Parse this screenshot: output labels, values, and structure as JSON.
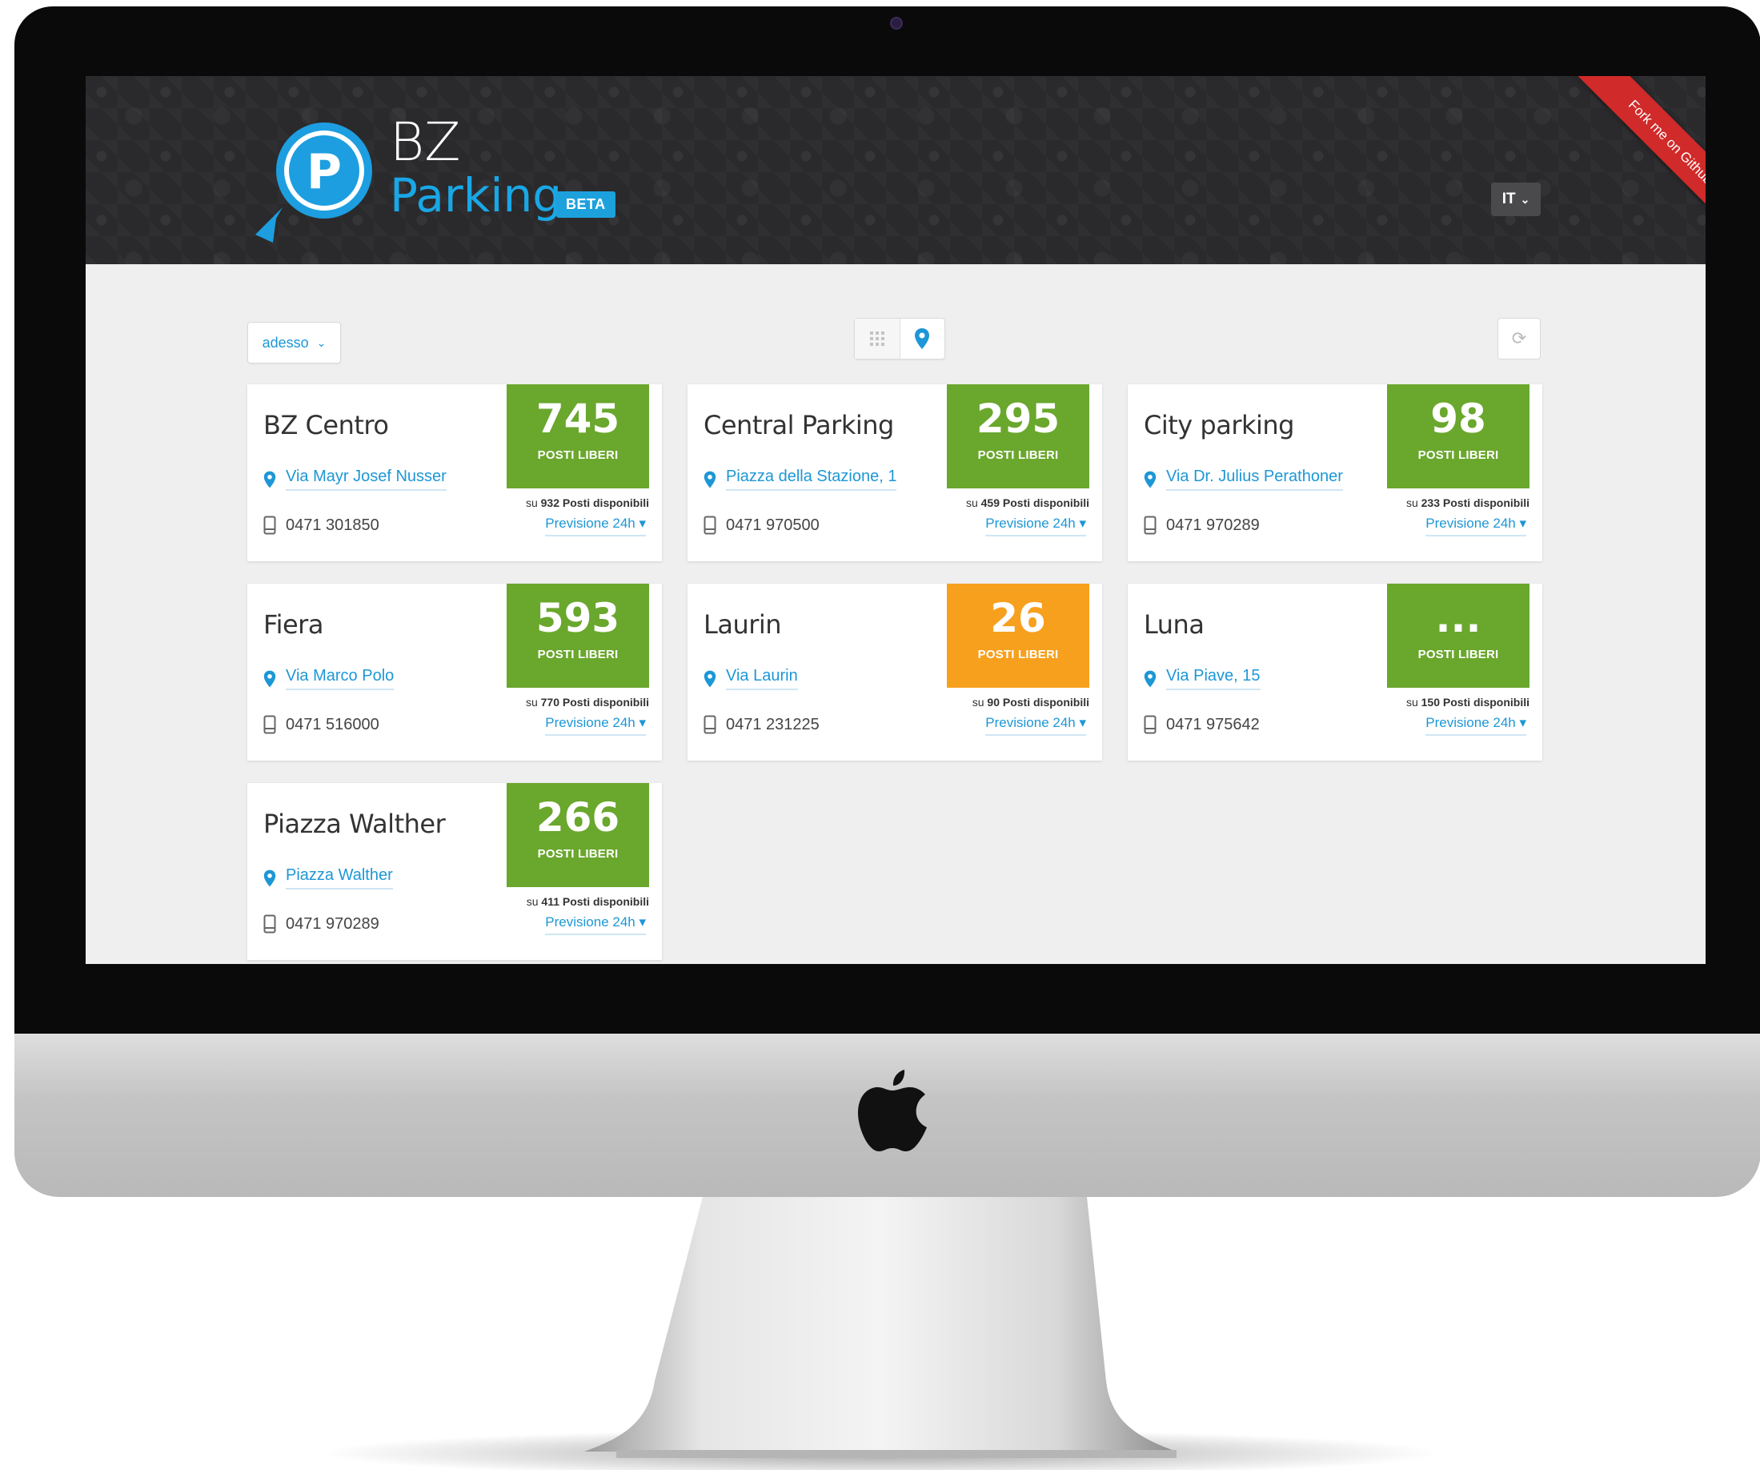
{
  "header": {
    "brand_line1": "BZ",
    "brand_line2": "Parking",
    "badge": "BETA",
    "language": "IT",
    "ribbon": "Fork me on Github"
  },
  "toolbar": {
    "time_select": "adesso",
    "views": [
      "grid-icon",
      "map-pin-icon"
    ],
    "active_view": "map-pin-icon"
  },
  "colors": {
    "accent": "#1d97d6",
    "status_ok": "#6aa72d",
    "status_warn": "#f7a01e",
    "ribbon": "#d12a2a",
    "header_bg": "#2a2a2c"
  },
  "cards": [
    {
      "name": "BZ Centro",
      "free": "745",
      "free_label": "POSTI LIBERI",
      "address": "Via Mayr Josef Nusser",
      "phone": "0471 301850",
      "total_prefix": "su 932 Posti disponibili",
      "forecast": "Previsione 24h ▾",
      "status": "ok"
    },
    {
      "name": "Central Parking",
      "free": "295",
      "free_label": "POSTI LIBERI",
      "address": "Piazza della Stazione, 1",
      "phone": "0471 970500",
      "total_prefix": "su 459 Posti disponibili",
      "forecast": "Previsione 24h ▾",
      "status": "ok"
    },
    {
      "name": "City parking",
      "free": "98",
      "free_label": "POSTI LIBERI",
      "address": "Via Dr. Julius Perathoner",
      "phone": "0471 970289",
      "total_prefix": "su 233 Posti disponibili",
      "forecast": "Previsione 24h ▾",
      "status": "ok"
    },
    {
      "name": "Fiera",
      "free": "593",
      "free_label": "POSTI LIBERI",
      "address": "Via Marco Polo",
      "phone": "0471 516000",
      "total_prefix": "su 770 Posti disponibili",
      "forecast": "Previsione 24h ▾",
      "status": "ok"
    },
    {
      "name": "Laurin",
      "free": "26",
      "free_label": "POSTI LIBERI",
      "address": "Via Laurin",
      "phone": "0471 231225",
      "total_prefix": "su 90 Posti disponibili",
      "forecast": "Previsione 24h ▾",
      "status": "warn"
    },
    {
      "name": "Luna",
      "free": "...",
      "free_label": "POSTI LIBERI",
      "address": "Via Piave, 15",
      "phone": "0471 975642",
      "total_prefix": "su 150 Posti disponibili",
      "forecast": "Previsione 24h ▾",
      "status": "ok"
    },
    {
      "name": "Piazza Walther",
      "free": "266",
      "free_label": "POSTI LIBERI",
      "address": "Piazza Walther",
      "phone": "0471 970289",
      "total_prefix": "su 411 Posti disponibili",
      "forecast": "Previsione 24h ▾",
      "status": "ok"
    }
  ]
}
